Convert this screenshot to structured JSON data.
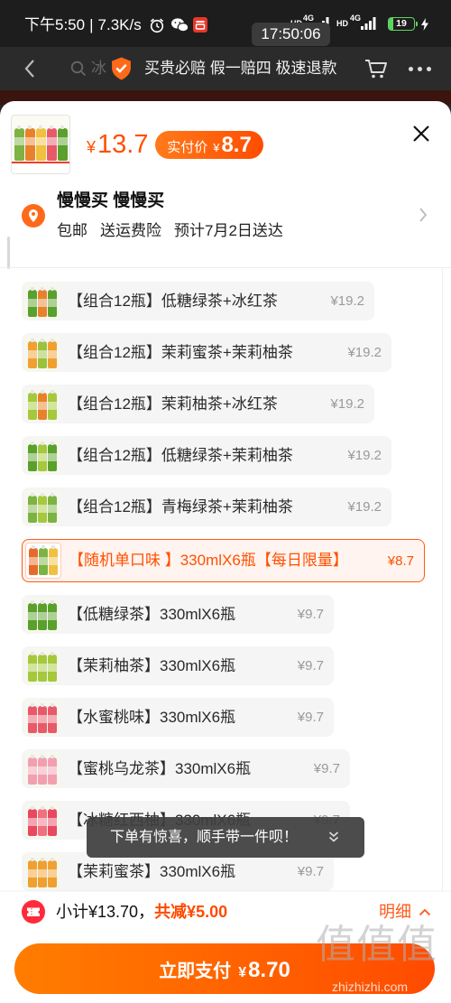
{
  "status_bar": {
    "time": "下午5:50",
    "separator": "|",
    "net_speed": "7.3K/s",
    "hd_label_1": "HD",
    "network_1": "4G",
    "hd_label_2": "HD",
    "network_2": "4G",
    "battery_level": "19"
  },
  "clock_overlay": "17:50:06",
  "nav": {
    "search_text": "冰",
    "guarantee_text": "买贵必赔 假一赔四 极速退款"
  },
  "sku_panel": {
    "price_symbol": "¥",
    "price": "13.7",
    "actual_price_label": "实付价",
    "actual_price_symbol": "¥",
    "actual_price": "8.7",
    "product_thumb_colors": [
      "#7cb342",
      "#e8822a",
      "#f0c040",
      "#e85a6a",
      "#5aa02c"
    ],
    "address": {
      "name": "慢慢买 慢慢买",
      "tags": [
        "包邮",
        "送运费险",
        "预计7月2日送达"
      ]
    },
    "options": [
      {
        "label": "【组合12瓶】低糖绿茶+冰红茶",
        "price": "¥19.2",
        "selected": false,
        "thumb_colors": [
          "#5aa02c",
          "#e8822a",
          "#5aa02c"
        ]
      },
      {
        "label": "【组合12瓶】茉莉蜜茶+茉莉柚茶",
        "price": "¥19.2",
        "selected": false,
        "thumb_colors": [
          "#f0a030",
          "#9bc23c",
          "#f0a030"
        ]
      },
      {
        "label": "【组合12瓶】茉莉柚茶+冰红茶",
        "price": "¥19.2",
        "selected": false,
        "thumb_colors": [
          "#a5c83c",
          "#e8822a",
          "#a5c83c"
        ]
      },
      {
        "label": "【组合12瓶】低糖绿茶+茉莉柚茶",
        "price": "¥19.2",
        "selected": false,
        "thumb_colors": [
          "#5aa02c",
          "#a5c83c",
          "#5aa02c"
        ]
      },
      {
        "label": "【组合12瓶】青梅绿茶+茉莉柚茶",
        "price": "¥19.2",
        "selected": false,
        "thumb_colors": [
          "#7cb342",
          "#a5c83c",
          "#7cb342"
        ]
      },
      {
        "label": "【随机单口味 】330mlX6瓶【每日限量】",
        "price": "¥8.7",
        "selected": true,
        "thumb_colors": [
          "#e86a2a",
          "#7cb342",
          "#f0c040"
        ]
      },
      {
        "label": "【低糖绿茶】330mlX6瓶",
        "price": "¥9.7",
        "selected": false,
        "thumb_colors": [
          "#5aa02c",
          "#5aa02c",
          "#5aa02c"
        ]
      },
      {
        "label": "【茉莉柚茶】330mlX6瓶",
        "price": "¥9.7",
        "selected": false,
        "thumb_colors": [
          "#a5c83c",
          "#a5c83c",
          "#a5c83c"
        ]
      },
      {
        "label": "【水蜜桃味】330mlX6瓶",
        "price": "¥9.7",
        "selected": false,
        "thumb_colors": [
          "#e85a6a",
          "#e85a6a",
          "#e85a6a"
        ]
      },
      {
        "label": "【蜜桃乌龙茶】330mlX6瓶",
        "price": "¥9.7",
        "selected": false,
        "thumb_colors": [
          "#f2a0b0",
          "#f2a0b0",
          "#f2a0b0"
        ]
      },
      {
        "label": "【冰糖红西柚】330mlX6瓶",
        "price": "¥9.7",
        "selected": false,
        "thumb_colors": [
          "#e84860",
          "#f07080",
          "#e84860"
        ]
      },
      {
        "label": "【茉莉蜜茶】330mlX6瓶",
        "price": "¥9.7",
        "selected": false,
        "thumb_colors": [
          "#f0a030",
          "#f0a030",
          "#f0a030"
        ]
      }
    ]
  },
  "toast": {
    "text": "下单有惊喜，顺手带一件呗！"
  },
  "footer": {
    "subtotal": "小计¥13.70，",
    "discount": "共减¥5.00",
    "detail_label": "明细",
    "pay_label": "立即支付",
    "pay_symbol": "¥",
    "pay_amount": "8.70"
  },
  "watermark": {
    "logo": "值值值",
    "site": "zhizhizhi.com"
  },
  "colors": {
    "accent": "#ff5000",
    "option_bg": "#f5f5f5",
    "selected_bg": "#fff4ef",
    "pay_gradient_start": "#ff7d00",
    "pay_gradient_end": "#ff4b00",
    "coupon": "#ff2a3a",
    "battery": "#5fd35f"
  },
  "icons": {
    "status": [
      "alarm-icon",
      "wechat-icon",
      "app-notification-icon",
      "signal-icon",
      "battery-icon",
      "charging-icon"
    ],
    "nav": [
      "back-icon",
      "search-icon",
      "shield-check-icon",
      "cart-icon",
      "more-icon"
    ],
    "panel": [
      "close-icon",
      "location-icon",
      "chevron-right-icon",
      "chevrons-down-icon",
      "coupon-icon",
      "chevron-up-icon"
    ]
  }
}
